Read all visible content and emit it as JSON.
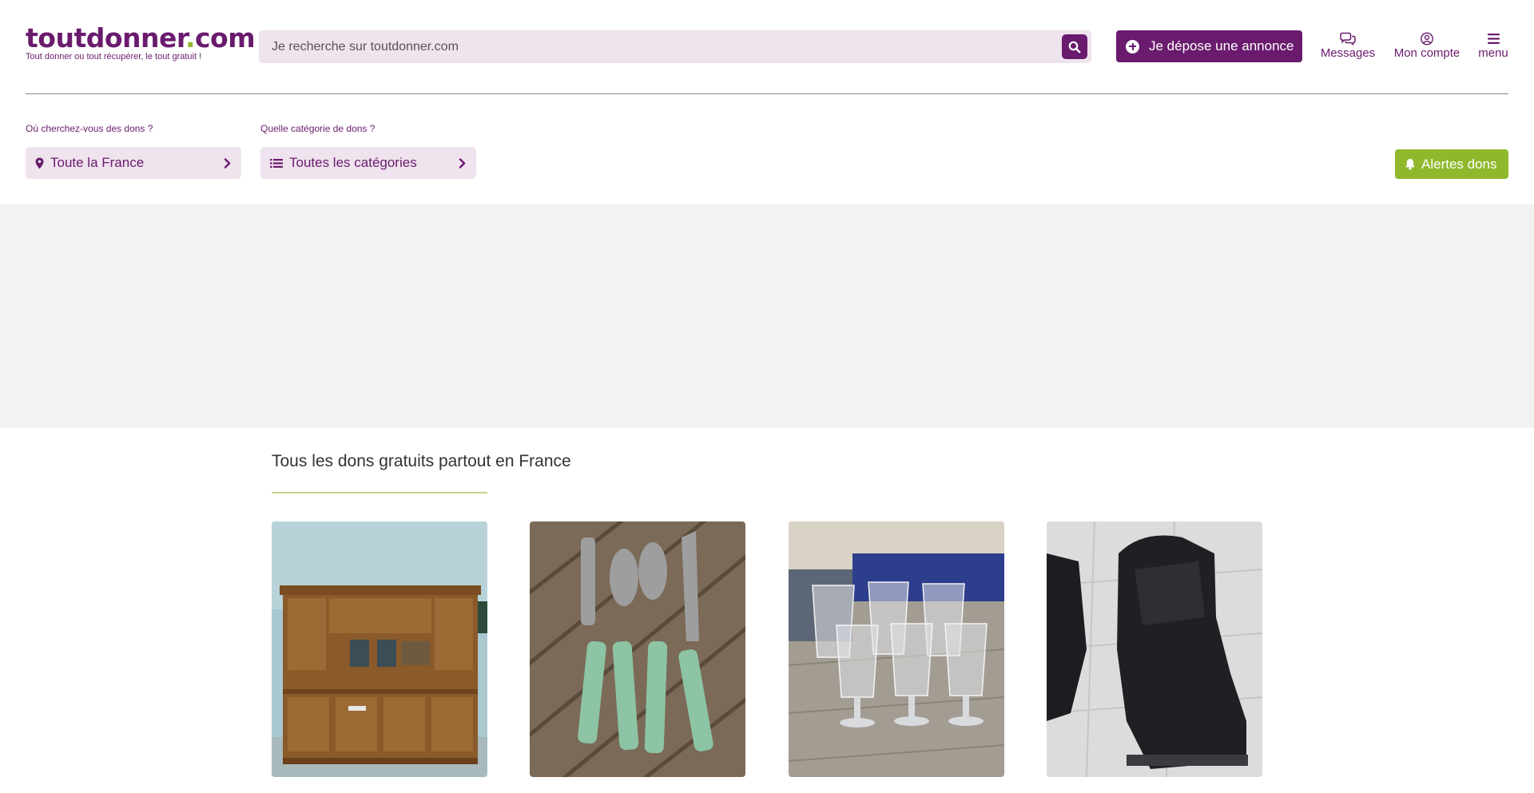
{
  "header": {
    "logo_main": "toutdonner",
    "logo_dot": ".",
    "logo_tld": "com",
    "logo_tagline": "Tout donner ou tout récupérer, le tout gratuit !",
    "search_placeholder": "Je recherche sur toutdonner.com",
    "search_icon": "magnifier-icon",
    "post_label": "Je dépose une annonce",
    "nav": {
      "messages": "Messages",
      "account": "Mon compte",
      "menu": "menu"
    }
  },
  "filters": {
    "location_label": "Où cherchez-vous des dons ?",
    "location_value": "Toute la France",
    "category_label": "Quelle catégorie de dons ?",
    "category_value": "Toutes les catégories",
    "alert_label": "Alertes dons"
  },
  "listings": {
    "title": "Tous les dons gratuits partout en France",
    "items": [
      {
        "image": "wooden-buffet-photo"
      },
      {
        "image": "cutlery-photo"
      },
      {
        "image": "glasses-photo"
      },
      {
        "image": "boots-photo"
      }
    ]
  },
  "colors": {
    "brand_purple": "#6a1b6e",
    "brand_green": "#8fb82c",
    "field_bg": "#efe3ee",
    "ad_band": "#f2f2f2"
  }
}
